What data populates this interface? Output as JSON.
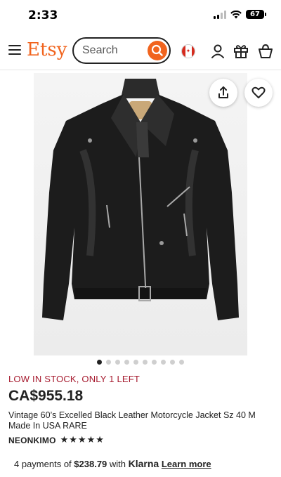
{
  "status_bar": {
    "time": "2:33",
    "battery": "67"
  },
  "header": {
    "logo": "Etsy",
    "search": {
      "placeholder": "Search"
    }
  },
  "product": {
    "image_count": 10,
    "active_image_index": 0,
    "stock_notice": "LOW IN STOCK, ONLY 1 LEFT",
    "price": "CA$955.18",
    "title": "Vintage 60’s Excelled Black Leather Motorcycle Jacket Sz 40 M Made In USA RARE",
    "shop_name": "NEONKIMO",
    "rating_stars": 5,
    "stars_text": "★★★★★"
  },
  "klarna": {
    "prefix": "4 payments of ",
    "amount": "$238.79",
    "middle": " with ",
    "brand": "Klarna",
    "link": "Learn more"
  },
  "colors": {
    "brand_orange": "#f1641e",
    "stock_red": "#a61a2e",
    "text": "#222222"
  },
  "icons": [
    "menu-icon",
    "search-icon",
    "canada-flag-icon",
    "account-icon",
    "gift-icon",
    "cart-icon",
    "share-icon",
    "heart-icon"
  ]
}
